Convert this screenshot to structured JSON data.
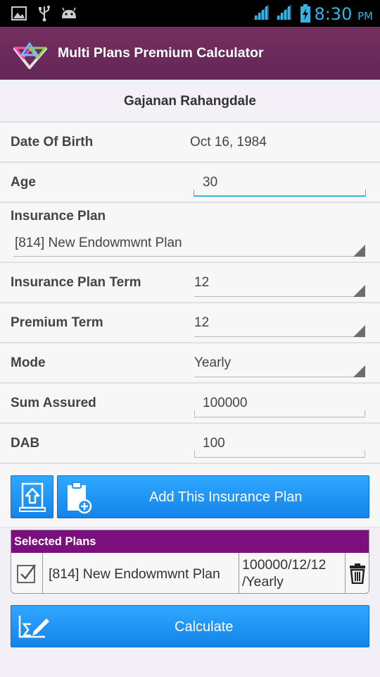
{
  "status_bar": {
    "time": "8:30",
    "ampm": "PM",
    "icons": [
      "image-icon",
      "usb-icon",
      "android-icon",
      "wifi-signal-icon",
      "cell-signal-icon",
      "battery-charging-icon"
    ]
  },
  "app_bar": {
    "title": "Multi Plans Premium Calculator",
    "logo_icon": "app-logo-icon"
  },
  "customer": {
    "name": "Gajanan Rahangdale"
  },
  "form": {
    "dob": {
      "label": "Date Of Birth",
      "value": "Oct 16, 1984"
    },
    "age": {
      "label": "Age",
      "value": "30"
    },
    "plan": {
      "label": "Insurance Plan",
      "value": "[814] New Endowmwnt Plan"
    },
    "plan_term": {
      "label": "Insurance Plan Term",
      "value": "12"
    },
    "premium_term": {
      "label": "Premium Term",
      "value": "12"
    },
    "mode": {
      "label": "Mode",
      "value": "Yearly"
    },
    "sum_assured": {
      "label": "Sum Assured",
      "value": "100000"
    },
    "dab": {
      "label": "DAB",
      "value": "100"
    }
  },
  "buttons": {
    "upload_icon": "upload-icon",
    "add_plan": "Add This Insurance Plan",
    "add_plan_icon": "clipboard-add-icon",
    "calculate": "Calculate",
    "calculate_icon": "sigma-pen-icon"
  },
  "selected_plans": {
    "header": "Selected Plans",
    "rows": [
      {
        "checked": true,
        "plan": "[814] New Endowmwnt Plan",
        "details_line1": "100000/12/12",
        "details_line2": "/Yearly"
      }
    ]
  },
  "colors": {
    "app_bar": "#6b2a5f",
    "button_blue": "#1e94f6",
    "selected_header": "#7c0f7e",
    "status_time": "#33b5e5",
    "active_field": "#33b5e5"
  }
}
